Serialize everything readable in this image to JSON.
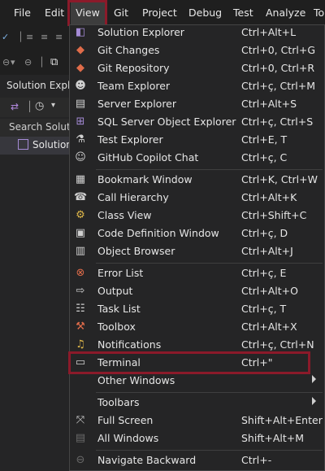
{
  "menubar": {
    "items": [
      {
        "label": "File"
      },
      {
        "label": "Edit"
      },
      {
        "label": "View"
      },
      {
        "label": "Git"
      },
      {
        "label": "Project"
      },
      {
        "label": "Debug"
      },
      {
        "label": "Test"
      },
      {
        "label": "Analyze"
      },
      {
        "label": "To"
      }
    ]
  },
  "solution_explorer": {
    "title": "Solution Explo",
    "search": "Search Solutio",
    "item": "Solution"
  },
  "view_menu": {
    "items": [
      {
        "label": "Solution Explorer",
        "shortcut": "Ctrl+Alt+L",
        "icon": "solution-explorer-icon"
      },
      {
        "label": "Git Changes",
        "shortcut": "Ctrl+0, Ctrl+G",
        "icon": "git-changes-icon"
      },
      {
        "label": "Git Repository",
        "shortcut": "Ctrl+0, Ctrl+R",
        "icon": "git-repository-icon"
      },
      {
        "label": "Team Explorer",
        "shortcut": "Ctrl+ç, Ctrl+M",
        "icon": "team-explorer-icon"
      },
      {
        "label": "Server Explorer",
        "shortcut": "Ctrl+Alt+S",
        "icon": "server-explorer-icon"
      },
      {
        "label": "SQL Server Object Explorer",
        "shortcut": "Ctrl+ç, Ctrl+S",
        "icon": "sql-server-icon"
      },
      {
        "label": "Test Explorer",
        "shortcut": "Ctrl+E, T",
        "icon": "test-explorer-icon"
      },
      {
        "label": "GitHub Copilot Chat",
        "shortcut": "Ctrl+ç, C",
        "icon": "copilot-icon"
      },
      {
        "label": "Bookmark Window",
        "shortcut": "Ctrl+K, Ctrl+W",
        "icon": "bookmark-icon"
      },
      {
        "label": "Call Hierarchy",
        "shortcut": "Ctrl+Alt+K",
        "icon": "call-hierarchy-icon"
      },
      {
        "label": "Class View",
        "shortcut": "Ctrl+Shift+C",
        "icon": "class-view-icon"
      },
      {
        "label": "Code Definition Window",
        "shortcut": "Ctrl+ç, D",
        "icon": "code-definition-icon"
      },
      {
        "label": "Object Browser",
        "shortcut": "Ctrl+Alt+J",
        "icon": "object-browser-icon"
      },
      {
        "label": "Error List",
        "shortcut": "Ctrl+ç, E",
        "icon": "error-list-icon"
      },
      {
        "label": "Output",
        "shortcut": "Ctrl+Alt+O",
        "icon": "output-icon"
      },
      {
        "label": "Task List",
        "shortcut": "Ctrl+ç, T",
        "icon": "task-list-icon"
      },
      {
        "label": "Toolbox",
        "shortcut": "Ctrl+Alt+X",
        "icon": "toolbox-icon"
      },
      {
        "label": "Notifications",
        "shortcut": "Ctrl+ç, Ctrl+N",
        "icon": "bell-icon"
      },
      {
        "label": "Terminal",
        "shortcut": "Ctrl+\"",
        "icon": "terminal-icon"
      },
      {
        "label": "Other Windows",
        "shortcut": "",
        "icon": ""
      },
      {
        "label": "Toolbars",
        "shortcut": "",
        "icon": ""
      },
      {
        "label": "Full Screen",
        "shortcut": "Shift+Alt+Enter",
        "icon": "full-screen-icon"
      },
      {
        "label": "All Windows",
        "shortcut": "Shift+Alt+M",
        "icon": "all-windows-icon"
      },
      {
        "label": "Navigate Backward",
        "shortcut": "Ctrl+-",
        "icon": "navigate-backward-icon"
      }
    ]
  },
  "colors": {
    "background": "#1f1f1f",
    "menu_background": "#252526",
    "highlight_border": "#8b1a2a",
    "active_menu": "#3d3d3d"
  }
}
